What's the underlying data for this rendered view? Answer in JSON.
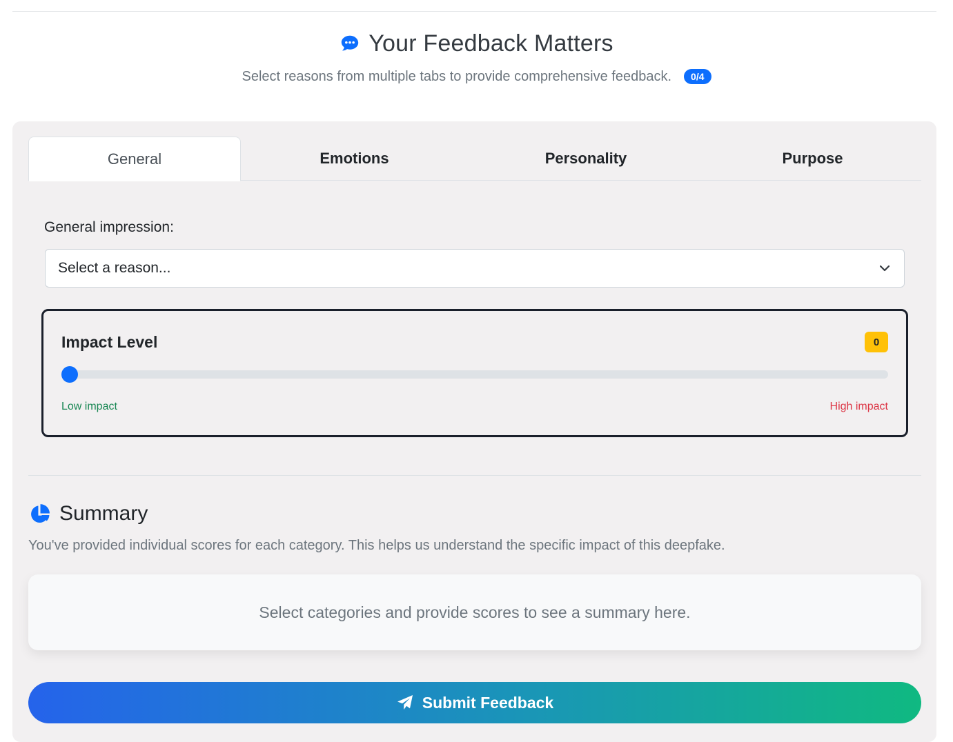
{
  "header": {
    "title": "Your Feedback Matters",
    "subtitle": "Select reasons from multiple tabs to provide comprehensive feedback.",
    "counter": "0/4",
    "title_icon": "chat-bubble-icon"
  },
  "tabs": [
    {
      "label": "General",
      "active": true
    },
    {
      "label": "Emotions",
      "active": false
    },
    {
      "label": "Personality",
      "active": false
    },
    {
      "label": "Purpose",
      "active": false
    }
  ],
  "general": {
    "field_label": "General impression:",
    "select_value": "Select a reason..."
  },
  "impact": {
    "title": "Impact Level",
    "value": "0",
    "slider_fraction": 0,
    "low_label": "Low impact",
    "high_label": "High impact"
  },
  "summary": {
    "title": "Summary",
    "icon": "pie-chart-icon",
    "description": "You've provided individual scores for each category. This helps us understand the specific impact of this deepfake.",
    "placeholder": "Select categories and provide scores to see a summary here."
  },
  "submit": {
    "label": "Submit Feedback",
    "icon": "paper-plane-icon"
  },
  "colors": {
    "accent": "#0d6efd",
    "badge_yellow": "#ffc107",
    "low": "#198754",
    "high": "#dc3545",
    "gradient_start": "#2563eb",
    "gradient_end": "#10b981"
  }
}
